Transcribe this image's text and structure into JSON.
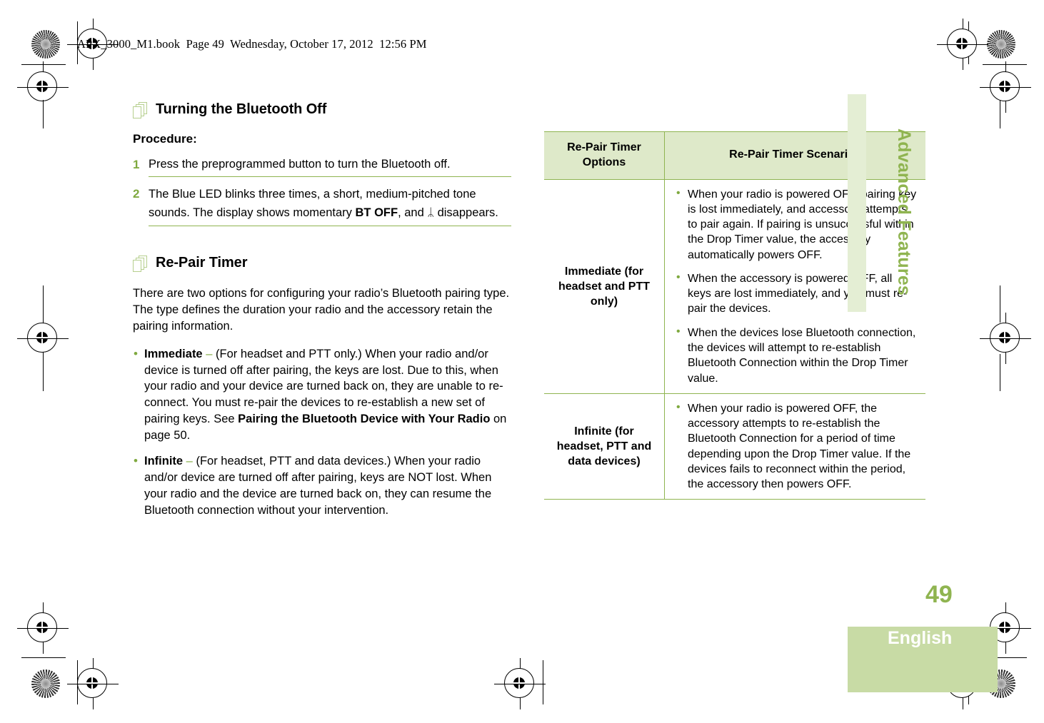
{
  "header": {
    "file_line": "APX_3000_M1.book  Page 49  Wednesday, October 17, 2012  12:56 PM"
  },
  "left_column": {
    "section1": {
      "icon": "pages-stack-icon",
      "title": "Turning the Bluetooth Off",
      "procedure_label": "Procedure:",
      "steps": [
        {
          "number": "1",
          "text": "Press the preprogrammed button to turn the Bluetooth off."
        },
        {
          "number": "2",
          "text_before_bold": "The Blue LED blinks three times, a short, medium-pitched tone sounds. The display shows momentary ",
          "bold": "BT OFF",
          "text_after_bold": ", and ",
          "bluetooth_glyph": "ᛦ",
          "text_end": " disappears."
        }
      ]
    },
    "section2": {
      "icon": "pages-stack-icon",
      "title": "Re-Pair Timer",
      "intro": "There are two options for configuring your radio’s Bluetooth pairing type. The type defines the duration your radio and the accessory retain the pairing information.",
      "bullets": [
        {
          "term": "Immediate",
          "dash": "–",
          "body_before_bold": " (For headset and PTT only.) When your radio and/or device is turned off after pairing, the keys are lost. Due to this, when your radio and your device are turned back on, they are unable to re-connect. You must re-pair the devices to re-establish a new set of pairing keys. See ",
          "reference": "Pairing the Bluetooth Device with Your Radio",
          "body_after_bold": " on page 50."
        },
        {
          "term": "Infinite",
          "dash": "–",
          "body_before_bold": " (For headset, PTT and data devices.) When your radio and/or device are turned off after pairing, keys are NOT lost. When your radio and the device are turned back on, they can resume the Bluetooth connection without your intervention.",
          "reference": "",
          "body_after_bold": ""
        }
      ]
    }
  },
  "table": {
    "headers": {
      "col1": "Re-Pair Timer Options",
      "col2": "Re-Pair Timer Scenarios"
    },
    "rows": [
      {
        "option": "Immediate (for headset and PTT only)",
        "scenarios": [
          "When your radio is powered OFF, pairing key is lost immediately, and accessory attempts to pair again. If pairing is unsuccessful within the Drop Timer value, the accessory automatically powers OFF.",
          "When the accessory is powered OFF, all keys are lost immediately, and you must re-pair the devices.",
          "When the devices lose Bluetooth connection, the devices will attempt to re-establish Bluetooth Connection within the Drop Timer value."
        ]
      },
      {
        "option": "Infinite (for headset, PTT and data devices)",
        "scenarios": [
          "When your radio is powered OFF, the accessory attempts to re-establish the Bluetooth Connection for a period of time depending upon the Drop Timer value. If the devices fails to reconnect within the period, the accessory then powers OFF."
        ]
      }
    ]
  },
  "chrome": {
    "chapter_title": "Advanced Features",
    "page_number": "49",
    "language": "English"
  },
  "colors": {
    "accent_green": "#8fb450",
    "bullet_green": "#7fa93f",
    "table_header_bg": "#dee9c9",
    "tab_bg": "#e4eed4",
    "lang_band_bg": "#c8dba5"
  }
}
